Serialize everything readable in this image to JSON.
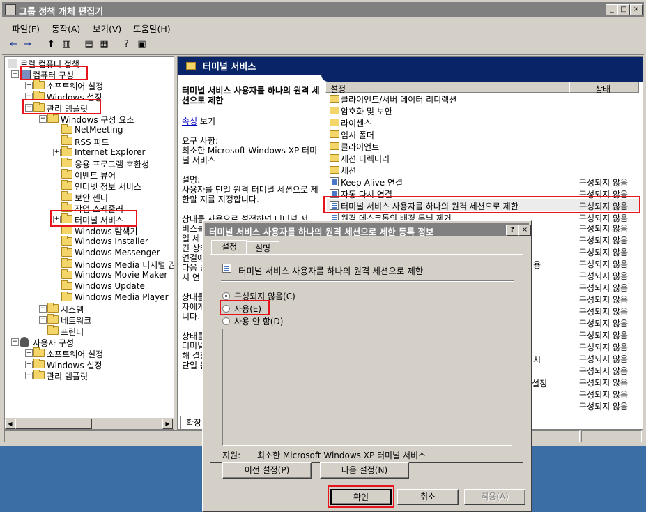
{
  "window": {
    "title": "그룹 정책 개체 편집기",
    "controls": [
      "_",
      "□",
      "×"
    ]
  },
  "menu": [
    "파일(F)",
    "동작(A)",
    "보기(V)",
    "도움말(H)"
  ],
  "tree": {
    "root": "로컬 컴퓨터 정책",
    "computer_config": "컴퓨터 구성",
    "software_settings": "소프트웨어 설정",
    "windows_settings": "Windows 설정",
    "admin_templates": "관리 템플릿",
    "windows_components": "Windows 구성 요소",
    "components": [
      "NetMeeting",
      "RSS 피드",
      "Internet Explorer",
      "응용 프로그램 호환성",
      "이벤트 뷰어",
      "인터넷 정보 서비스",
      "보안 센터",
      "작업 스케줄러",
      "터미널 서비스",
      "Windows 탐색기",
      "Windows Installer",
      "Windows Messenger",
      "Windows Media 디지털 권",
      "Windows Movie Maker",
      "Windows Update",
      "Windows Media Player"
    ],
    "system": "시스템",
    "network": "네트워크",
    "printers": "프린터",
    "user_config": "사용자 구성",
    "user_software": "소프트웨어 설정",
    "user_windows": "Windows 설정",
    "user_admin": "관리 템플릿"
  },
  "right": {
    "header": "터미널 서비스",
    "desc_title": "터미널 서비스 사용자를 하나의 원격 세션으로 제한",
    "desc_link": "속성",
    "desc_link_suffix": " 보기",
    "req_label": "요구 사항:",
    "req_text": "최소한 Microsoft Windows XP 터미널 서비스",
    "desc_label": "설명:",
    "desc_text": "사용자를 단일 원격 터미널 세션으로 제한할 지를 지정합니다.",
    "desc_more1": "상태를 사용으로 설정하면 터미널 서",
    "desc_more1b": "비스를",
    "desc_more2": "일 세",
    "desc_more3": "긴 상태",
    "desc_more4": "연결에",
    "desc_more5": "다음 번",
    "desc_more6": "시 연",
    "desc_more7": "상태를",
    "desc_more8": "자에게",
    "desc_more9": "니다.",
    "desc_more10": "상태를",
    "desc_more11": "터미널",
    "desc_more12": "해 결정",
    "desc_more13": "단일 원",
    "tab_extended": "확장",
    "col_setting": "설정",
    "col_state": "상태",
    "folders": [
      "클라이언트/서버 데이터 리디렉션",
      "암호화 및 보안",
      "라이센스",
      "임시 폴더",
      "클라이언트",
      "세션 디렉터리",
      "세션"
    ],
    "policies": [
      {
        "name": "Keep-Alive 연결",
        "state": "구성되지 않음"
      },
      {
        "name": "자동 다시 연결",
        "state": "구성되지 않음"
      },
      {
        "name": "터미널 서비스 사용자를 하나의 원격 세션으로 제한",
        "state": "구성되지 않음"
      },
      {
        "name": "원격 데스크톱의 배경 무늬 제거",
        "state": "구성되지 않음"
      }
    ],
    "extra_states": [
      "구성되지 않음",
      "구성되지 않음",
      "구성되지 않음",
      "구성되지 않음",
      "구성되지 않음",
      "구성되지 않음",
      "구성되지 않음",
      "구성되지 않음",
      "구성되지 않음",
      "구성되지 않음",
      "구성되지 않음",
      "구성되지 않음",
      "구성되지 않음",
      "구성되지 않음",
      "구성되지 않음",
      "구성되지 않음"
    ],
    "partial_text": [
      "용",
      "시",
      "설정"
    ]
  },
  "dialog": {
    "title": "터미널 서비스 사용자를 하나의 원격 세션으로 제한 등록 정보",
    "help": "?",
    "close": "×",
    "tab_setting": "설정",
    "tab_desc": "설명",
    "policy_name": "터미널 서비스 사용자를 하나의 원격 세션으로 제한",
    "opt_not_configured": "구성되지 않음(C)",
    "opt_enabled": "사용(E)",
    "opt_disabled": "사용 안 함(D)",
    "support_label": "지원:",
    "support_text": "최소한 Microsoft Windows XP 터미널 서비스",
    "prev": "이전 설정(P)",
    "next": "다음 설정(N)",
    "ok": "확인",
    "cancel": "취소",
    "apply": "적용(A)"
  },
  "colors": {
    "highlight": "#e8141c",
    "header_band": "#0a2468",
    "desktop": "#3a6ea5"
  }
}
